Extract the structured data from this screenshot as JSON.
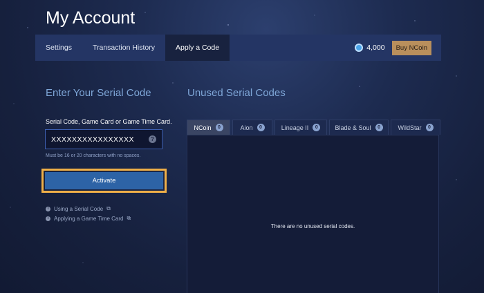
{
  "page": {
    "title": "My Account"
  },
  "nav": {
    "tabs": [
      {
        "label": "Settings",
        "active": false
      },
      {
        "label": "Transaction History",
        "active": false
      },
      {
        "label": "Apply a Code",
        "active": true
      }
    ],
    "balance": "4,000",
    "buy_label": "Buy NCoin",
    "buy_color": "#b98f5c"
  },
  "serial": {
    "title": "Enter Your Serial Code",
    "label": "Serial Code, Game Card or Game Time Card.",
    "value": "XXXXXXXXXXXXXXXX",
    "help_icon": "?",
    "hint": "Must be 16 or 20 characters with no spaces.",
    "activate_label": "Activate",
    "highlight_color": "#f0b048",
    "links": [
      {
        "label": "Using a Serial Code",
        "icon": "info-icon"
      },
      {
        "label": "Applying a Game Time Card",
        "icon": "info-icon"
      }
    ]
  },
  "unused": {
    "title": "Unused Serial Codes",
    "tabs": [
      {
        "label": "NCoin",
        "count": "0",
        "active": true
      },
      {
        "label": "Aion",
        "count": "0",
        "active": false
      },
      {
        "label": "Lineage II",
        "count": "0",
        "active": false
      },
      {
        "label": "Blade & Soul",
        "count": "0",
        "active": false
      },
      {
        "label": "WildStar",
        "count": "0",
        "active": false
      }
    ],
    "empty_message": "There are no unused serial codes."
  }
}
